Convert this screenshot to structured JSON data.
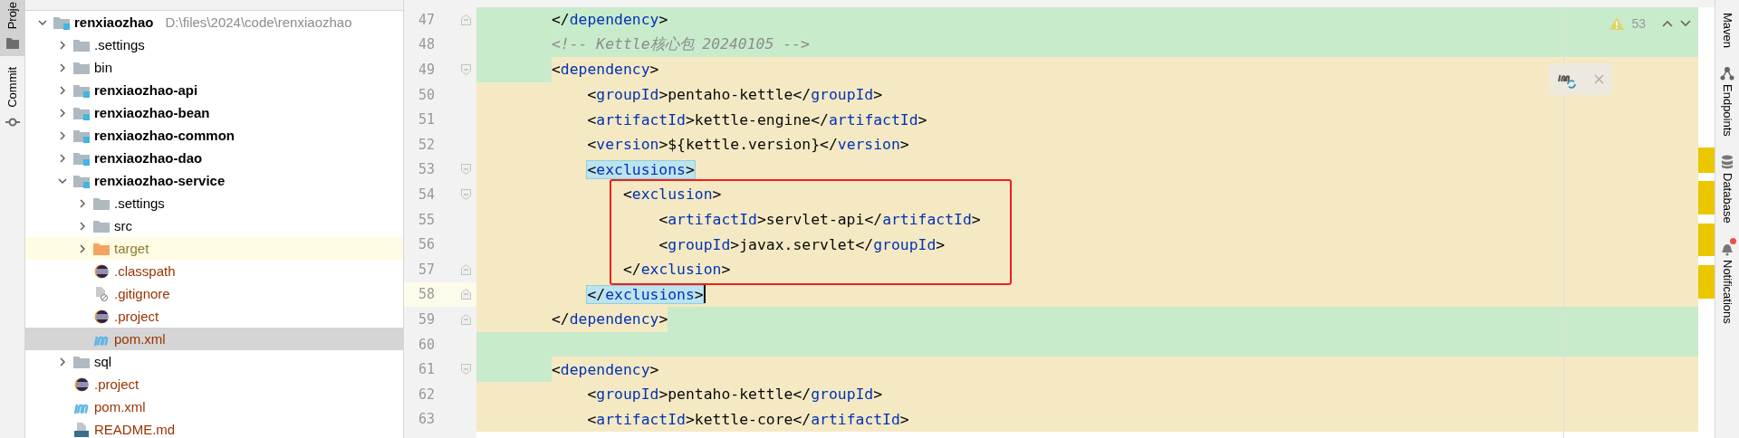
{
  "left_toolbar": [
    {
      "label": "Proje",
      "kind": "folder",
      "selected": true
    },
    {
      "label": "Commit",
      "kind": "commit",
      "selected": false
    }
  ],
  "project_tree": {
    "items": [
      {
        "name": "renxiaozhao",
        "path": "D:\\files\\2024\\code\\renxiaozhao",
        "kind": "module",
        "expanded": true,
        "selected": false,
        "color": "#000000",
        "children": [
          {
            "name": ".settings",
            "kind": "folder",
            "expanded": false,
            "selected": false,
            "color": "#000000"
          },
          {
            "name": "bin",
            "kind": "folder",
            "expanded": false,
            "selected": false,
            "color": "#000000"
          },
          {
            "name": "renxiaozhao-api",
            "kind": "module",
            "expanded": false,
            "selected": false,
            "color": "#000000"
          },
          {
            "name": "renxiaozhao-bean",
            "kind": "module",
            "expanded": false,
            "selected": false,
            "color": "#000000"
          },
          {
            "name": "renxiaozhao-common",
            "kind": "module",
            "expanded": false,
            "selected": false,
            "color": "#000000"
          },
          {
            "name": "renxiaozhao-dao",
            "kind": "module",
            "expanded": false,
            "selected": false,
            "color": "#000000"
          },
          {
            "name": "renxiaozhao-service",
            "kind": "module",
            "expanded": true,
            "selected": false,
            "color": "#000000",
            "children": [
              {
                "name": ".settings",
                "kind": "folder",
                "expanded": false,
                "selected": false,
                "color": "#000000"
              },
              {
                "name": "src",
                "kind": "folder",
                "expanded": false,
                "selected": false,
                "color": "#000000"
              },
              {
                "name": "target",
                "kind": "excluded_folder",
                "expanded": false,
                "selected": false,
                "color": "#8c7a30"
              },
              {
                "name": ".classpath",
                "kind": "eclipse",
                "selected": false,
                "color": "#993300"
              },
              {
                "name": ".gitignore",
                "kind": "ignore_file",
                "selected": false,
                "color": "#993300"
              },
              {
                "name": ".project",
                "kind": "eclipse",
                "selected": false,
                "color": "#993300"
              },
              {
                "name": "pom.xml",
                "kind": "maven",
                "selected": true,
                "color": "#993300"
              }
            ]
          },
          {
            "name": "sql",
            "kind": "folder",
            "expanded": false,
            "selected": false,
            "color": "#000000"
          },
          {
            "name": ".project",
            "kind": "eclipse",
            "selected": false,
            "color": "#993300"
          },
          {
            "name": "pom.xml",
            "kind": "maven",
            "selected": false,
            "color": "#993300"
          },
          {
            "name": "README.md",
            "kind": "markdown",
            "selected": false,
            "color": "#993300"
          }
        ]
      }
    ]
  },
  "editor": {
    "inspections": {
      "warnings": "53"
    },
    "lines": [
      {
        "number": "47",
        "kind": "code",
        "text": "        </dependency>",
        "color": "#c8ebcc",
        "fold_start": false,
        "fold_end": true,
        "match": false,
        "caret": false
      },
      {
        "number": "48",
        "kind": "comment",
        "text": "        <!-- Kettle核心包 20240105 -->",
        "color": "#c8ebcc",
        "fold_start": false,
        "fold_end": false,
        "match": false,
        "caret": false
      },
      {
        "number": "49",
        "kind": "code",
        "text": "        <dependency>",
        "color": "#f5e9c4",
        "indent_added": true,
        "fold_start": true,
        "fold_end": false,
        "match": false,
        "caret": false
      },
      {
        "number": "50",
        "kind": "code",
        "text": "            <groupId>pentaho-kettle</groupId>",
        "color": "#f5e9c4",
        "fold_start": false,
        "fold_end": false,
        "match": false,
        "caret": false
      },
      {
        "number": "51",
        "kind": "code",
        "text": "            <artifactId>kettle-engine</artifactId>",
        "color": "#f5e9c4",
        "fold_start": false,
        "fold_end": false,
        "match": false,
        "caret": false
      },
      {
        "number": "52",
        "kind": "code",
        "text": "            <version>${kettle.version}</version>",
        "color": "#f5e9c4",
        "fold_start": false,
        "fold_end": false,
        "match": false,
        "caret": false
      },
      {
        "number": "53",
        "kind": "code",
        "text": "            <exclusions>",
        "color": "#f5e9c4",
        "fold_start": true,
        "fold_end": false,
        "match": true,
        "caret": false
      },
      {
        "kind": "highlight_box",
        "lines": [
          {
            "number": "54",
            "kind": "code",
            "text": "                <exclusion>",
            "color": "#f5e9c4",
            "fold_start": true,
            "fold_end": false,
            "match": false,
            "caret": false
          },
          {
            "number": "55",
            "kind": "code",
            "text": "                    <artifactId>servlet-api</artifactId>",
            "color": "#f5e9c4",
            "fold_start": false,
            "fold_end": false,
            "match": false,
            "caret": false
          },
          {
            "number": "56",
            "kind": "code",
            "text": "                    <groupId>javax.servlet</groupId>",
            "color": "#f5e9c4",
            "fold_start": false,
            "fold_end": false,
            "match": false,
            "caret": false
          },
          {
            "number": "57",
            "kind": "code",
            "text": "                </exclusion>",
            "color": "#f5e9c4",
            "fold_start": false,
            "fold_end": true,
            "match": false,
            "caret": false
          }
        ]
      },
      {
        "number": "58",
        "kind": "code",
        "text": "            </exclusions>",
        "color": "#f5e9c4",
        "fold_start": false,
        "fold_end": true,
        "match": true,
        "caret": true
      },
      {
        "number": "59",
        "kind": "code",
        "text": "        </dependency>",
        "color": "#f5e9c4",
        "tail_added": true,
        "fold_start": false,
        "fold_end": true,
        "match": false,
        "caret": false
      },
      {
        "number": "60",
        "kind": "code",
        "color": "#c8ebcc",
        "fold_start": false,
        "fold_end": false
      },
      {
        "number": "61",
        "kind": "code",
        "text": "        <dependency>",
        "color": "#f5e9c4",
        "indent_added": true,
        "fold_start": true,
        "fold_end": false,
        "match": false,
        "caret": false
      },
      {
        "number": "62",
        "kind": "code",
        "text": "            <groupId>pentaho-kettle</groupId>",
        "color": "#f5e9c4",
        "fold_start": false,
        "fold_end": false,
        "match": false,
        "caret": false
      },
      {
        "number": "63",
        "kind": "code",
        "text": "            <artifactId>kettle-core</artifactId>",
        "color": "#f5e9c4",
        "fold_start": false,
        "fold_end": false,
        "match": false,
        "caret": false
      }
    ]
  },
  "right_toolbar": [
    {
      "label": "Maven",
      "kind": "maven",
      "badge": false
    },
    {
      "label": "Endpoints",
      "kind": "endpoints",
      "badge": false
    },
    {
      "label": "Database",
      "kind": "database",
      "badge": false
    },
    {
      "label": "Notifications",
      "kind": "bell",
      "badge": true
    }
  ]
}
